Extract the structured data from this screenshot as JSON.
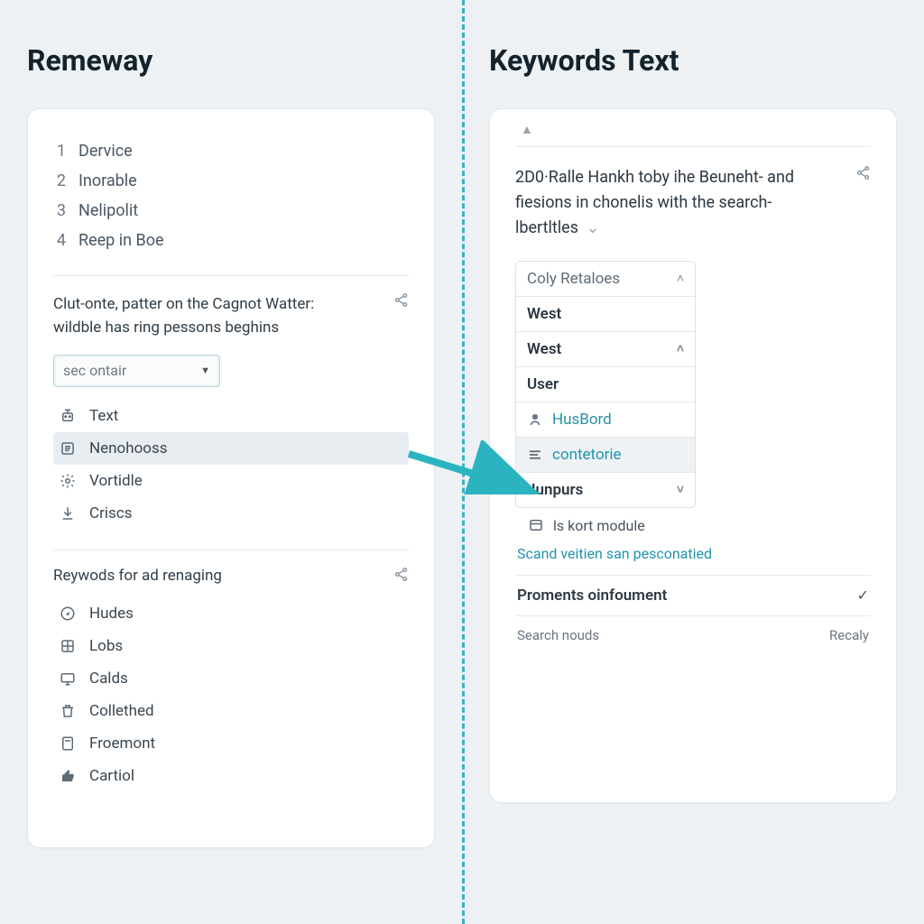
{
  "left": {
    "title": "Remeway",
    "numbered": [
      {
        "n": "1",
        "label": "Dervice"
      },
      {
        "n": "2",
        "label": "Inorable"
      },
      {
        "n": "3",
        "label": "Nelipolit"
      },
      {
        "n": "4",
        "label": "Reep in Boe"
      }
    ],
    "block1": {
      "text": "Clut-onte, patter on the Cagnot Watter: wildble has ring pessons beghins",
      "select_placeholder": "sec ontair",
      "options": [
        {
          "icon": "robot-icon",
          "label": "Text"
        },
        {
          "icon": "list-icon",
          "label": "Nenohooss",
          "highlight": true
        },
        {
          "icon": "gear-icon",
          "label": "Vortidle"
        },
        {
          "icon": "download-icon",
          "label": "Criscs"
        }
      ]
    },
    "block2": {
      "title": "Reywods for ad renaging",
      "items": [
        {
          "icon": "compass-icon",
          "label": "Hudes"
        },
        {
          "icon": "grid-icon",
          "label": "Lobs"
        },
        {
          "icon": "monitor-icon",
          "label": "Calds"
        },
        {
          "icon": "trash-icon",
          "label": "Collethed"
        },
        {
          "icon": "calc-icon",
          "label": "Froemont"
        },
        {
          "icon": "thumb-icon",
          "label": "Cartiol"
        }
      ]
    }
  },
  "right": {
    "title": "Keywords Text",
    "summary": "2D0·Ralle Hankh toby ihe Beuneht- and fiesions in chonelis with the search-lbertltles",
    "panel": {
      "header": "Coly Retaloes",
      "rows": [
        {
          "label": "West",
          "type": "bold"
        },
        {
          "label": "West",
          "type": "bold",
          "chev": "up"
        },
        {
          "label": "User",
          "type": "bold"
        }
      ],
      "items": [
        {
          "icon": "person-icon",
          "label": "HusBord",
          "variant": "hus"
        },
        {
          "icon": "lines-icon",
          "label": "contetorie",
          "variant": "hl"
        }
      ],
      "junpurs": "Junpurs"
    },
    "module": {
      "label": "ls kort module"
    },
    "link": "Scand veitien san pesconatied",
    "footer": [
      {
        "left": "Proments oinfoument",
        "right_icon": "check"
      },
      {
        "left": "Search nouds",
        "right_text": "Recaly"
      }
    ]
  }
}
